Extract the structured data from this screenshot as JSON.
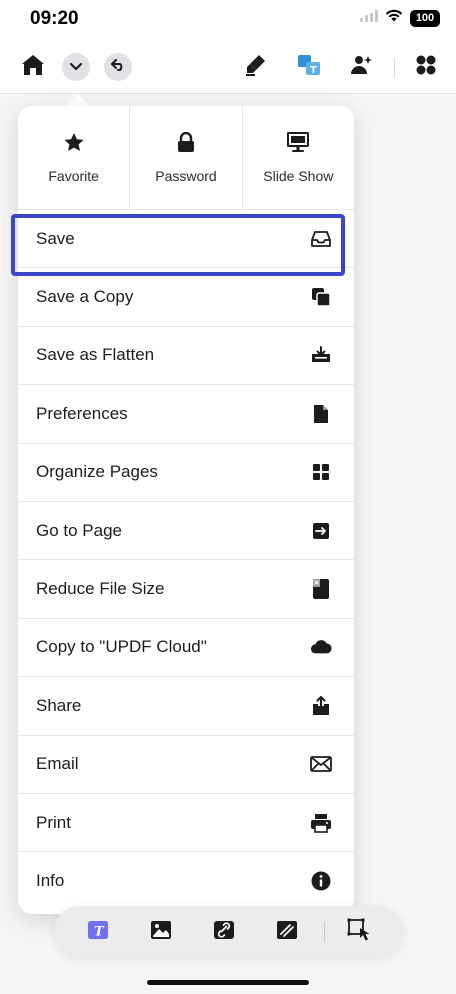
{
  "status_bar": {
    "time": "09:20",
    "battery": "100"
  },
  "toolbar": {
    "icons": [
      "home-icon",
      "chevron-down-icon",
      "undo-icon",
      "highlighter-icon",
      "translate-icon",
      "portrait-icon",
      "apps-icon"
    ],
    "accent": "#2f8fd8"
  },
  "quick_actions": [
    {
      "label": "Favorite",
      "icon": "star-icon"
    },
    {
      "label": "Password",
      "icon": "lock-icon"
    },
    {
      "label": "Slide Show",
      "icon": "presentation-icon"
    }
  ],
  "menu": [
    {
      "label": "Save",
      "icon": "tray-icon"
    },
    {
      "label": "Save a Copy",
      "icon": "copy-icon"
    },
    {
      "label": "Save as Flatten",
      "icon": "flatten-icon"
    },
    {
      "label": "Preferences",
      "icon": "document-icon"
    },
    {
      "label": "Organize Pages",
      "icon": "grid-icon"
    },
    {
      "label": "Go to Page",
      "icon": "goto-icon"
    },
    {
      "label": "Reduce File Size",
      "icon": "compress-icon"
    },
    {
      "label": "Copy to \"UPDF Cloud\"",
      "icon": "cloud-icon"
    },
    {
      "label": "Share",
      "icon": "share-icon"
    },
    {
      "label": "Email",
      "icon": "envelope-icon"
    },
    {
      "label": "Print",
      "icon": "printer-icon"
    },
    {
      "label": "Info",
      "icon": "info-icon"
    }
  ],
  "highlight_color": "#3d45c8",
  "bottom_toolbar": {
    "icons": [
      "text-icon",
      "image-icon",
      "link-icon",
      "crop-icon",
      "select-icon"
    ],
    "accent": "#6f6ff0"
  }
}
